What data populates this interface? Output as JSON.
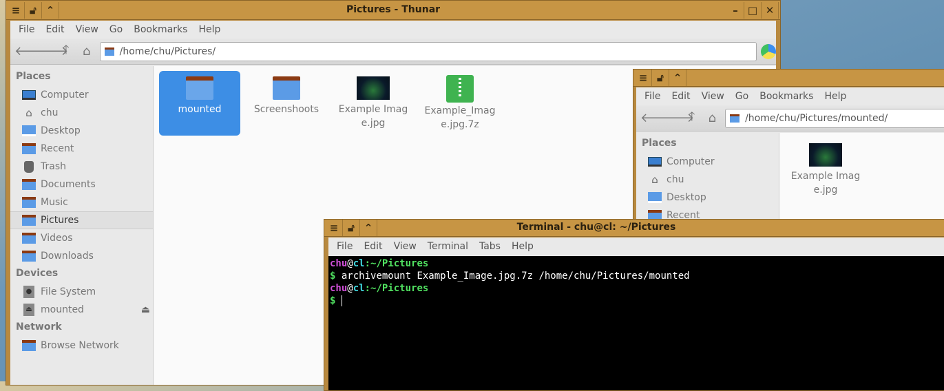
{
  "thunar1": {
    "title": "Pictures - Thunar",
    "menu": [
      "File",
      "Edit",
      "View",
      "Go",
      "Bookmarks",
      "Help"
    ],
    "path": "/home/chu/Pictures/",
    "sidebar": [
      {
        "type": "h",
        "label": "Places"
      },
      {
        "label": "Computer",
        "icon": "computer-icon"
      },
      {
        "label": "chu",
        "icon": "home-icon"
      },
      {
        "label": "Desktop",
        "icon": "desktop-icon"
      },
      {
        "label": "Recent",
        "icon": "recent-folder-icon"
      },
      {
        "label": "Trash",
        "icon": "trash-icon"
      },
      {
        "label": "Documents",
        "icon": "documents-folder-icon"
      },
      {
        "label": "Music",
        "icon": "music-folder-icon"
      },
      {
        "label": "Pictures",
        "icon": "pictures-folder-icon",
        "selected": true
      },
      {
        "label": "Videos",
        "icon": "videos-folder-icon"
      },
      {
        "label": "Downloads",
        "icon": "downloads-folder-icon"
      },
      {
        "type": "h",
        "label": "Devices"
      },
      {
        "label": "File System",
        "icon": "drive-icon"
      },
      {
        "label": "mounted",
        "icon": "mounted-drive-icon",
        "eject": true
      },
      {
        "type": "h",
        "label": "Network"
      },
      {
        "label": "Browse Network",
        "icon": "network-folder-icon"
      }
    ],
    "files": [
      {
        "name": "mounted",
        "kind": "folder",
        "selected": true
      },
      {
        "name": "Screenshoots",
        "kind": "folder"
      },
      {
        "name": "Example Image.jpg",
        "kind": "image"
      },
      {
        "name": "Example_Image.jpg.7z",
        "kind": "archive"
      }
    ]
  },
  "thunar2": {
    "menu": [
      "File",
      "Edit",
      "View",
      "Go",
      "Bookmarks",
      "Help"
    ],
    "path": "/home/chu/Pictures/mounted/",
    "sidebar": [
      {
        "type": "h",
        "label": "Places"
      },
      {
        "label": "Computer",
        "icon": "computer-icon"
      },
      {
        "label": "chu",
        "icon": "home-icon"
      },
      {
        "label": "Desktop",
        "icon": "desktop-icon"
      },
      {
        "label": "Recent",
        "icon": "recent-folder-icon"
      }
    ],
    "files": [
      {
        "name": "Example Image.jpg",
        "kind": "image"
      }
    ]
  },
  "terminal": {
    "title": "Terminal - chu@cl: ~/Pictures",
    "menu": [
      "File",
      "Edit",
      "View",
      "Terminal",
      "Tabs",
      "Help"
    ],
    "prompt": {
      "user": "chu",
      "at": "@",
      "host": "cl",
      "path": ":~/Pictures",
      "sign": "$"
    },
    "command": "archivemount Example_Image.jpg.7z /home/chu/Pictures/mounted"
  },
  "colors": {
    "titlebar": "#c79544",
    "selection": "#3d8ee5",
    "prompt_user": "#d050d8",
    "prompt_host": "#40d8e0",
    "prompt_path": "#50e060"
  }
}
